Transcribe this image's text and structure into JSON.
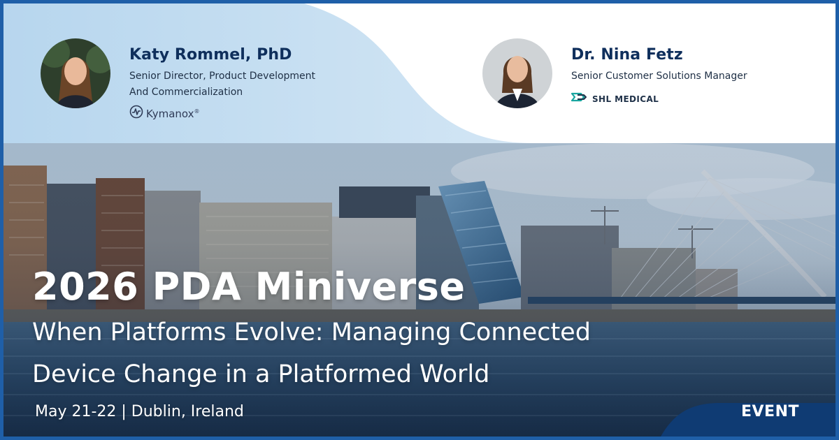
{
  "speakers": [
    {
      "name": "Katy Rommel, PhD",
      "role_line_1": "Senior Director, Product Development",
      "role_line_2": "And Commercialization",
      "company": "Kymanox",
      "company_mark": "®"
    },
    {
      "name": "Dr. Nina Fetz",
      "role_line_1": "Senior Customer Solutions Manager",
      "company": "SHL MEDICAL"
    }
  ],
  "event": {
    "title": "2026 PDA Miniverse",
    "subtitle_line_1": "When Platforms Evolve: Managing Connected",
    "subtitle_line_2": "Device Change in a Platformed World",
    "date_location": "May 21-22 | Dublin, Ireland",
    "badge": "EVENT"
  },
  "colors": {
    "frame": "#1f5fa8",
    "name_text": "#0f2f5c",
    "badge_bg": "#0f3b73",
    "shl_teal": "#1aa6a0"
  },
  "icons": {
    "kymanox_logo": "kymanox-logo",
    "shl_logo": "shl-medical-logo"
  }
}
